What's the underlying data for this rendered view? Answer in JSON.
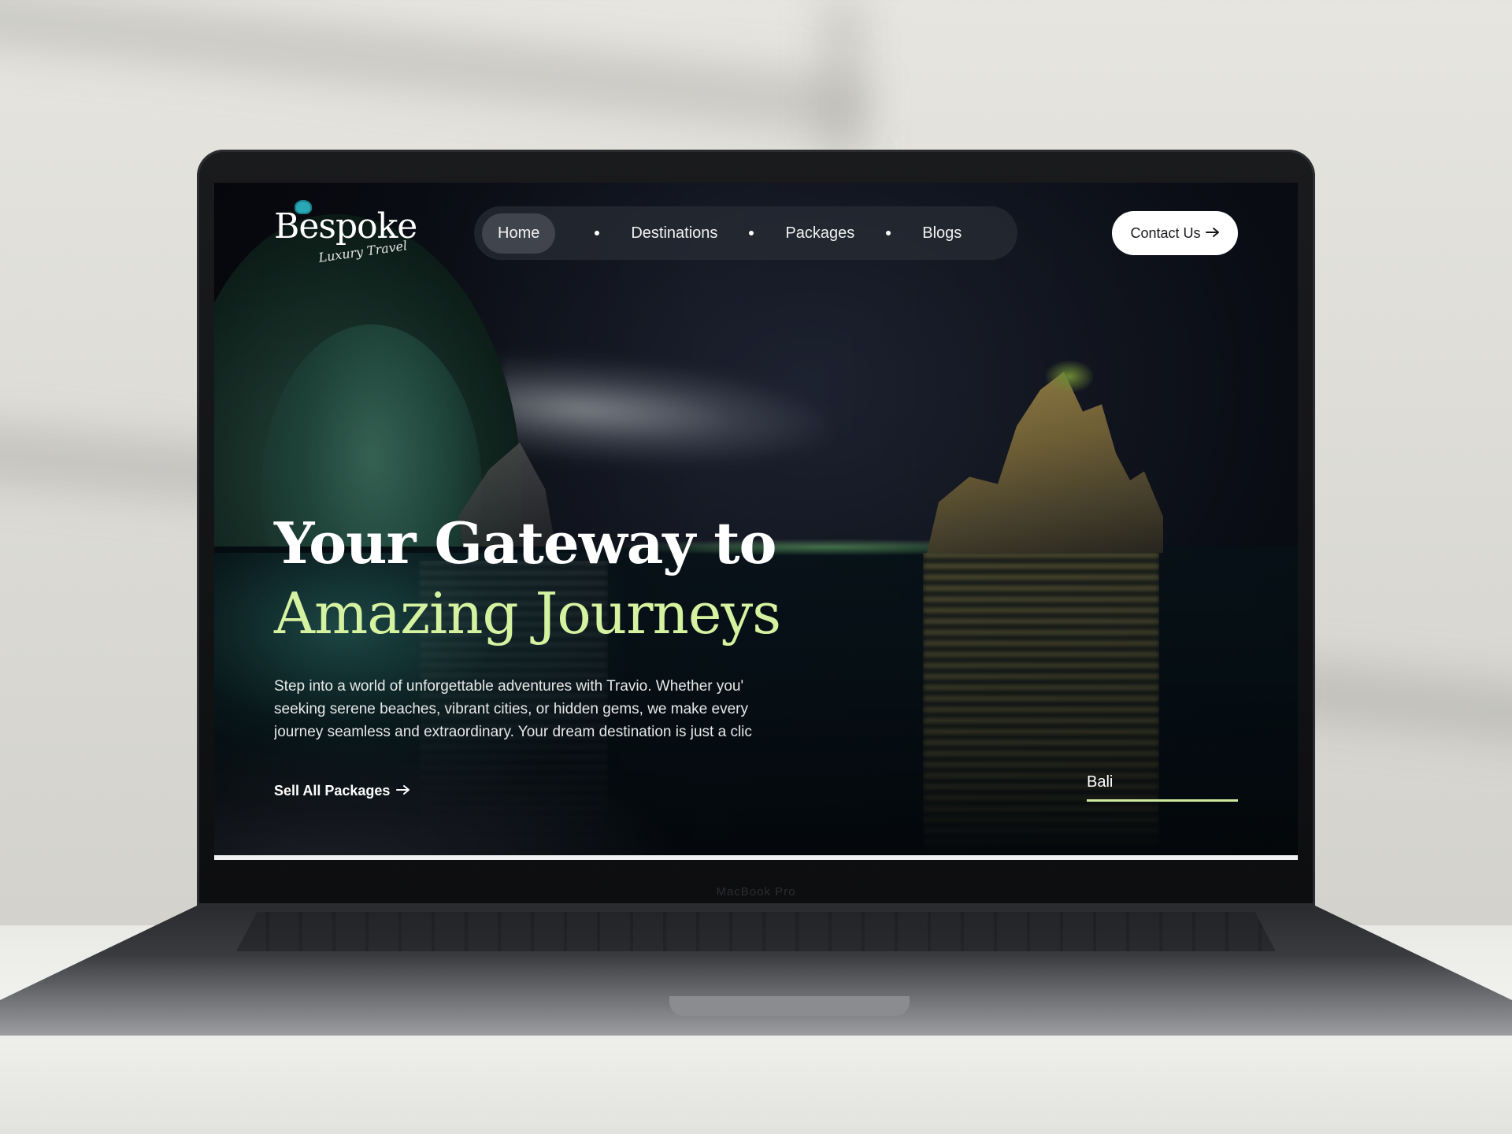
{
  "brand": {
    "name": "Bespoke",
    "tagline": "Luxury Travel"
  },
  "nav": {
    "items": [
      {
        "label": "Home",
        "active": true
      },
      {
        "label": "Destinations",
        "active": false
      },
      {
        "label": "Packages",
        "active": false
      },
      {
        "label": "Blogs",
        "active": false
      }
    ],
    "contact_label": "Contact Us",
    "contact_icon": "arrow-right-icon"
  },
  "hero": {
    "headline_line1": "Your Gateway to",
    "headline_line2": "Amazing Journeys",
    "description_lines": [
      "Step into a world of unforgettable adventures with Travio. Whether you'",
      "seeking serene beaches, vibrant cities, or hidden gems, we make every",
      "journey seamless and extraordinary. Your dream destination is just a clic"
    ],
    "cta_label": "Sell All Packages",
    "cta_icon": "arrow-right-icon",
    "location_label": "Bali"
  },
  "device": {
    "label": "MacBook Pro"
  },
  "colors": {
    "accent_green": "#d5f2a0",
    "underline": "#cfe9a0",
    "nav_bg": "#282c34",
    "button_bg": "#ffffff"
  }
}
